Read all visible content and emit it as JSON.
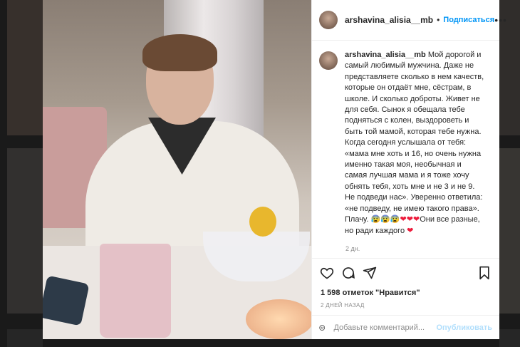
{
  "post": {
    "username": "arshavina_alisia__mb",
    "follow_label": "Подписаться",
    "more_label": "•••",
    "caption_text": "Мой дорогой и самый любимый мужчина. Даже не представляете сколько в нем качеств, которые он отдаёт мне, сёстрам, в школе. И сколько доброты. Живет не для себя. Сынок я обещала тебе подняться с колен, выздороветь и быть той мамой, которая тебе нужна. Когда сегодня услышала от тебя: «мама мне хоть и 16, но очень нужна именно такая моя, необычная и самая лучшая мама и я тоже хочу обнять тебя, хоть мне и не 3 и не 9. Не подведи нас». Уверенно ответила: «не подведу, не имею такого права». Плачу. 😰😰😰",
    "caption_hearts": "❤❤❤",
    "caption_tail": "Они все разные, но ради каждого ",
    "caption_end_heart": "❤",
    "comment_time": "2 дн.",
    "likes": "1 598 отметок \"Нравится\"",
    "date": "2 ДНЕЙ НАЗАД",
    "comment_placeholder": "Добавьте комментарий...",
    "publish_label": "Опубликовать"
  },
  "icons": [
    "heart-icon",
    "comment-icon",
    "share-icon",
    "bookmark-icon",
    "emoji-icon"
  ],
  "colors": {
    "link": "#0095f6",
    "publish_disabled": "#b2dffc",
    "text": "#262626",
    "muted": "#8e8e8e"
  }
}
